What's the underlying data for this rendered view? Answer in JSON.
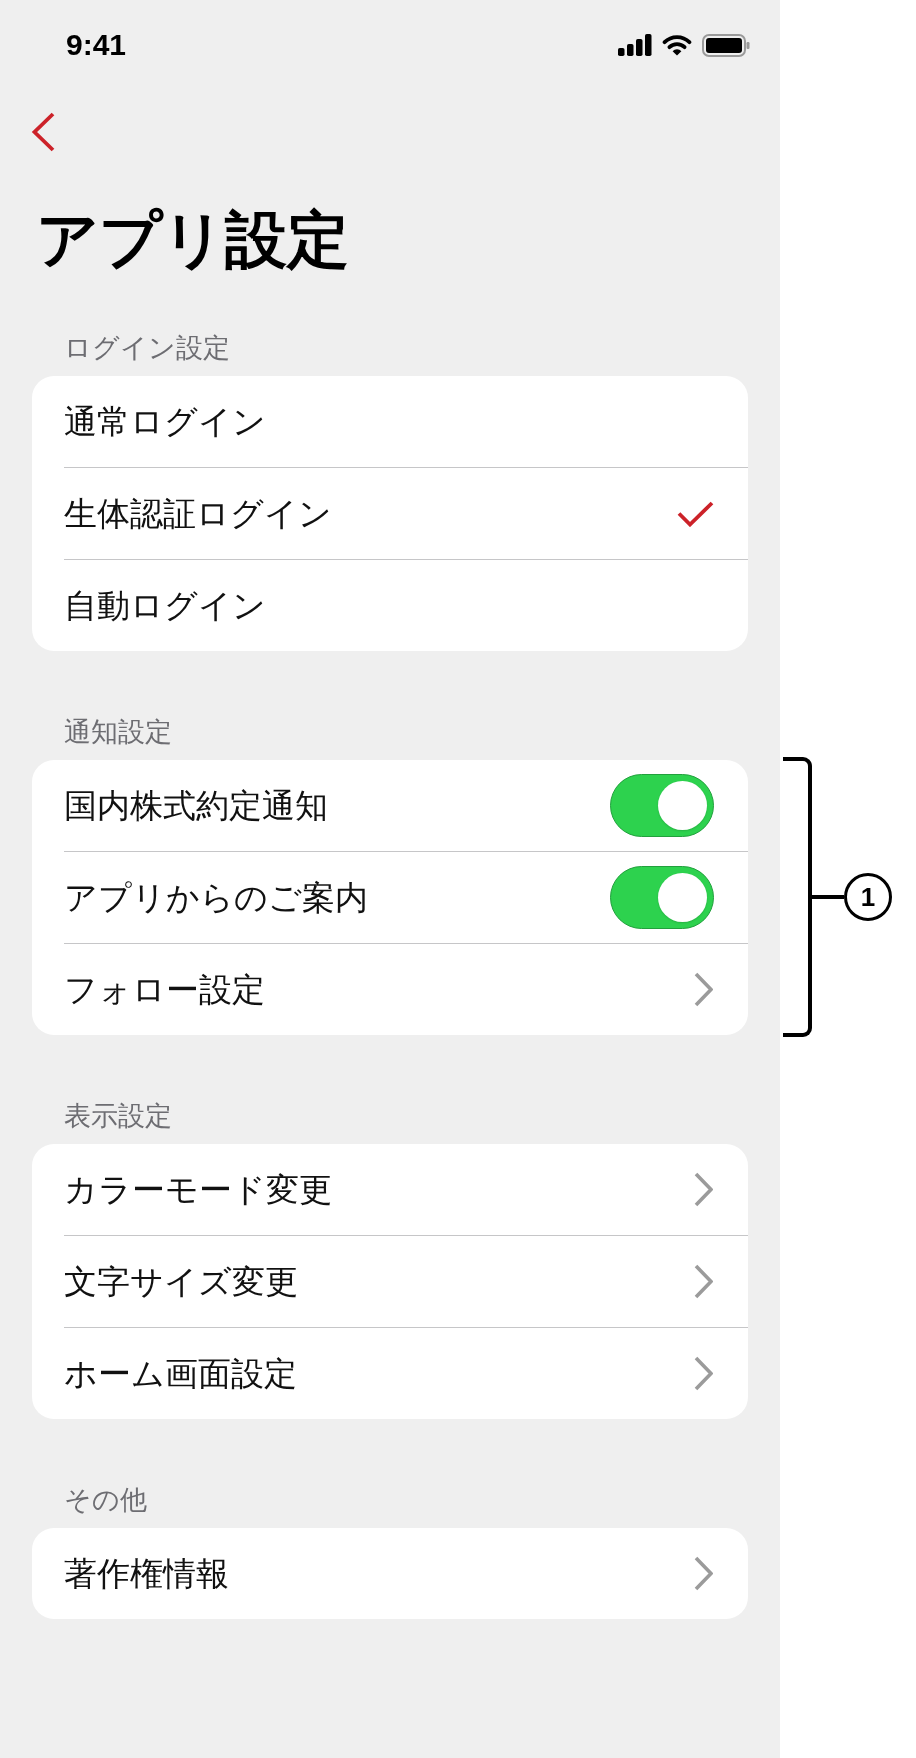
{
  "status_bar": {
    "time": "9:41"
  },
  "title": "アプリ設定",
  "sections": [
    {
      "header": "ログイン設定",
      "rows": [
        {
          "kind": "option",
          "label": "通常ログイン",
          "selected": false
        },
        {
          "kind": "option",
          "label": "生体認証ログイン",
          "selected": true
        },
        {
          "kind": "option",
          "label": "自動ログイン",
          "selected": false
        }
      ]
    },
    {
      "header": "通知設定",
      "annotation": "1",
      "rows": [
        {
          "kind": "toggle",
          "label": "国内株式約定通知",
          "on": true
        },
        {
          "kind": "toggle",
          "label": "アプリからのご案内",
          "on": true
        },
        {
          "kind": "link",
          "label": "フォロー設定"
        }
      ]
    },
    {
      "header": "表示設定",
      "rows": [
        {
          "kind": "link",
          "label": "カラーモード変更"
        },
        {
          "kind": "link",
          "label": "文字サイズ変更"
        },
        {
          "kind": "link",
          "label": "ホーム画面設定"
        }
      ]
    },
    {
      "header": "その他",
      "rows": [
        {
          "kind": "link",
          "label": "著作権情報"
        }
      ]
    }
  ]
}
